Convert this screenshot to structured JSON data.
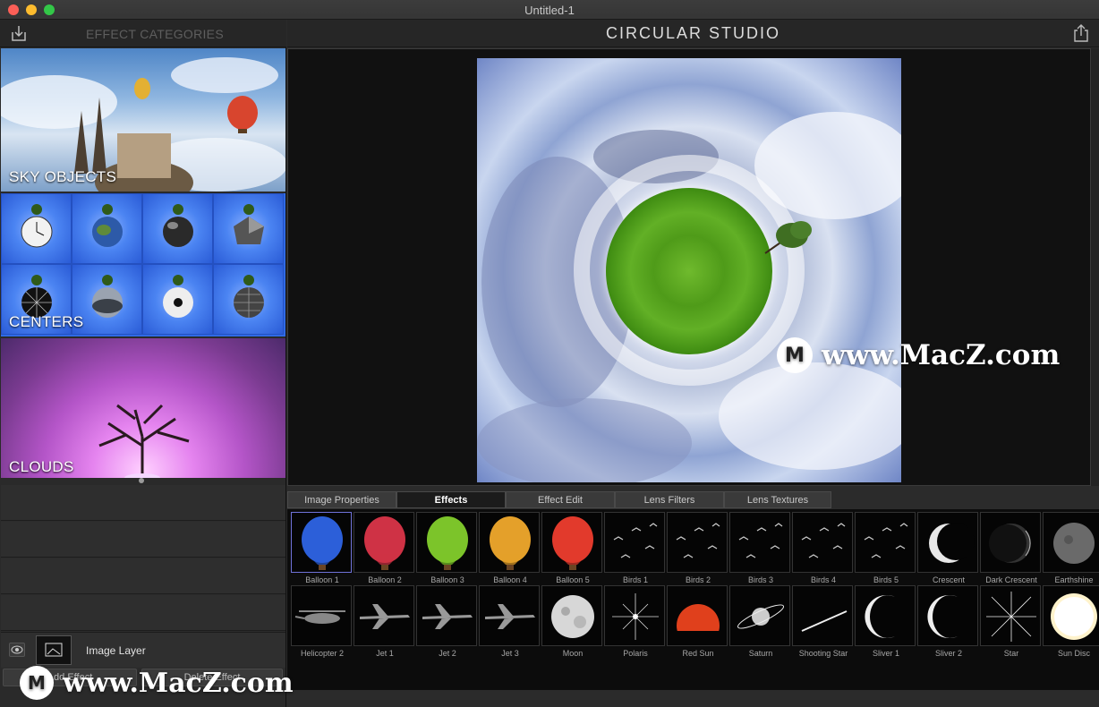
{
  "window": {
    "title": "Untitled-1"
  },
  "sidebar": {
    "title": "EFFECT CATEGORIES",
    "categories": [
      {
        "label": "SKY OBJECTS"
      },
      {
        "label": "CENTERS"
      },
      {
        "label": "CLOUDS"
      }
    ],
    "layer": {
      "name": "Image Layer"
    },
    "buttons": {
      "add": "Add Effect",
      "delete": "Delete Effect"
    }
  },
  "header": {
    "app_title": "CIRCULAR STUDIO"
  },
  "tabs": [
    {
      "label": "Image Properties",
      "active": false
    },
    {
      "label": "Effects",
      "active": true
    },
    {
      "label": "Effect Edit",
      "active": false
    },
    {
      "label": "Lens Filters",
      "active": false
    },
    {
      "label": "Lens Textures",
      "active": false
    }
  ],
  "effects": [
    {
      "label": "Balloon 1",
      "icon": "balloon-blue-icon",
      "color": "#2c5fd9"
    },
    {
      "label": "Balloon 2",
      "icon": "balloon-red-icon",
      "color": "#cf3245"
    },
    {
      "label": "Balloon 3",
      "icon": "balloon-green-icon",
      "color": "#7cc42a"
    },
    {
      "label": "Balloon 4",
      "icon": "balloon-rainbow-icon",
      "color": "#e4a02a"
    },
    {
      "label": "Balloon 5",
      "icon": "balloon-multicolor-icon",
      "color": "#e23a2c"
    },
    {
      "label": "Birds 1",
      "icon": "birds-icon"
    },
    {
      "label": "Birds 2",
      "icon": "birds-icon"
    },
    {
      "label": "Birds 3",
      "icon": "birds-icon"
    },
    {
      "label": "Birds 4",
      "icon": "birds-icon"
    },
    {
      "label": "Birds 5",
      "icon": "birds-icon"
    },
    {
      "label": "Crescent",
      "icon": "crescent-icon"
    },
    {
      "label": "Dark Crescent",
      "icon": "dark-crescent-icon"
    },
    {
      "label": "Earthshine",
      "icon": "earthshine-icon"
    },
    {
      "label": "Helicopter 2",
      "icon": "helicopter-icon"
    },
    {
      "label": "Jet 1",
      "icon": "jet-icon"
    },
    {
      "label": "Jet 2",
      "icon": "jet-icon"
    },
    {
      "label": "Jet 3",
      "icon": "jet-icon"
    },
    {
      "label": "Moon",
      "icon": "moon-icon"
    },
    {
      "label": "Polaris",
      "icon": "polaris-star-icon"
    },
    {
      "label": "Red Sun",
      "icon": "red-sun-icon"
    },
    {
      "label": "Saturn",
      "icon": "saturn-icon"
    },
    {
      "label": "Shooting Star",
      "icon": "shooting-star-icon"
    },
    {
      "label": "Sliver 1",
      "icon": "sliver-moon-icon"
    },
    {
      "label": "Sliver 2",
      "icon": "sliver-moon-icon"
    },
    {
      "label": "Star",
      "icon": "star-icon"
    },
    {
      "label": "Sun Disc",
      "icon": "sun-disc-icon"
    }
  ],
  "watermark": {
    "text": "www.MacZ.com",
    "logo": "M"
  }
}
